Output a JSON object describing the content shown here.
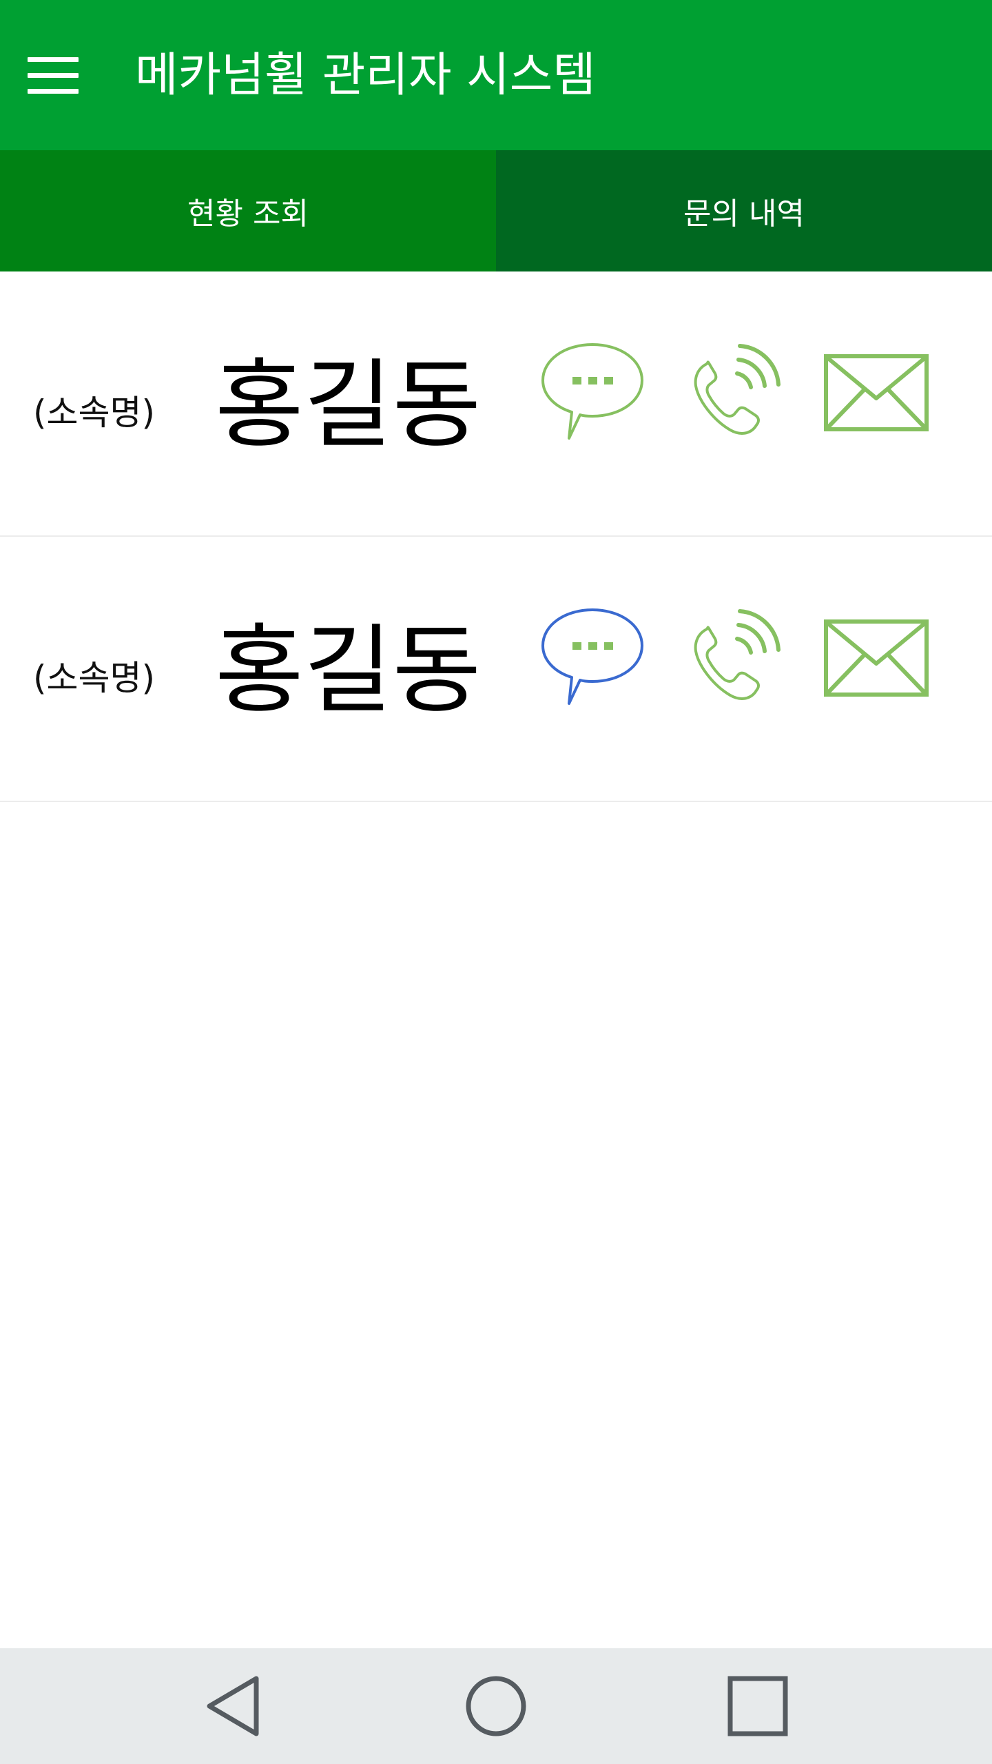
{
  "app": {
    "title": "메카넘휠 관리자 시스템",
    "brand_color": "#00a032"
  },
  "toolbar": {
    "menu_icon": "hamburger-menu-icon"
  },
  "tabs": [
    {
      "label": "현황 조회",
      "selected": true,
      "color": "#008214"
    },
    {
      "label": "문의 내역",
      "selected": false,
      "color": "#006820"
    }
  ],
  "contacts": [
    {
      "affiliation": "(소속명)",
      "name": "홍길동",
      "chat_icon": "chat-bubble-icon",
      "chat_color": "#86c060",
      "phone_icon": "phone-icon",
      "mail_icon": "mail-icon"
    },
    {
      "affiliation": "(소속명)",
      "name": "홍길동",
      "chat_icon": "chat-bubble-icon",
      "chat_color": "#3a6ad0",
      "phone_icon": "phone-icon",
      "mail_icon": "mail-icon"
    }
  ],
  "colors": {
    "icon_green": "#86c060",
    "icon_blue": "#3a6ad0",
    "nav_bar": "#e7eaeb"
  },
  "system_nav": {
    "back_icon": "back-triangle-icon",
    "home_icon": "home-circle-icon",
    "recent_icon": "recent-apps-square-icon"
  }
}
